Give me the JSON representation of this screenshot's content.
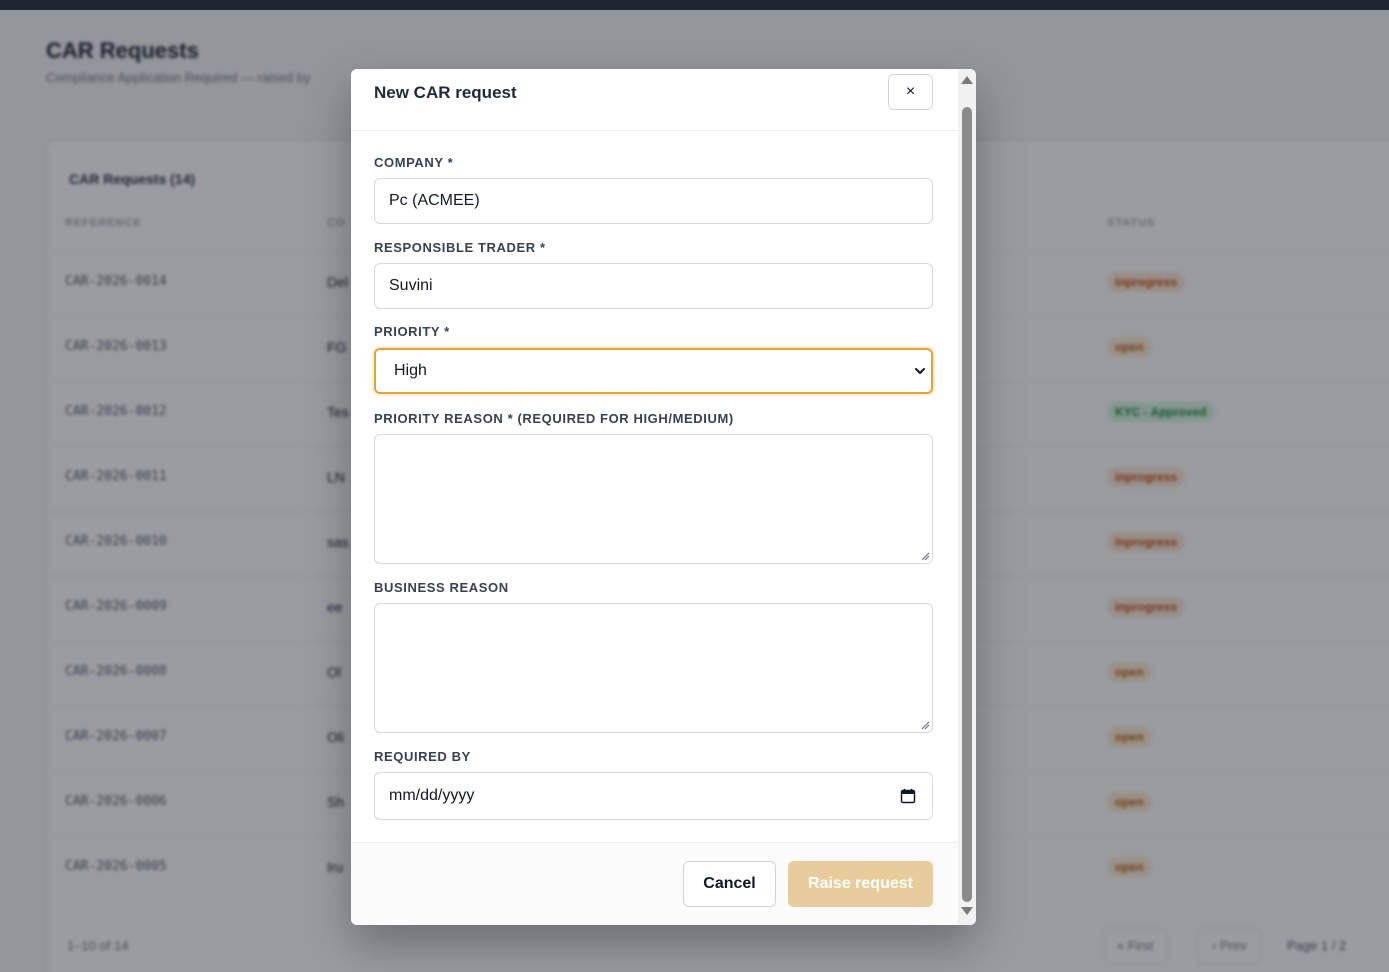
{
  "page": {
    "title": "CAR Requests",
    "subtitle": "Compliance Application Required — raised by"
  },
  "table": {
    "card_title": "CAR Requests (14)",
    "columns": [
      "REFERENCE",
      "CO",
      "STATUS"
    ],
    "rows": [
      {
        "ref": "CAR-2026-0014",
        "company": "Del",
        "status": "inprogress",
        "kind": "inprogress"
      },
      {
        "ref": "CAR-2026-0013",
        "company": "FG",
        "status": "open",
        "kind": "open"
      },
      {
        "ref": "CAR-2026-0012",
        "company": "Tes",
        "status": "KYC - Approved",
        "kind": "approved"
      },
      {
        "ref": "CAR-2026-0011",
        "company": "LN",
        "status": "inprogress",
        "kind": "inprogress"
      },
      {
        "ref": "CAR-2026-0010",
        "company": "sas",
        "status": "inprogress",
        "kind": "inprogress"
      },
      {
        "ref": "CAR-2026-0009",
        "company": "ee",
        "status": "inprogress",
        "kind": "inprogress"
      },
      {
        "ref": "CAR-2026-0008",
        "company": "Ol",
        "status": "open",
        "kind": "open"
      },
      {
        "ref": "CAR-2026-0007",
        "company": "Oli",
        "status": "open",
        "kind": "open"
      },
      {
        "ref": "CAR-2026-0006",
        "company": "Sh",
        "status": "open",
        "kind": "open"
      },
      {
        "ref": "CAR-2026-0005",
        "company": "Iru",
        "status": "open",
        "kind": "open"
      }
    ],
    "footer_count": "1–10 of 14",
    "pagination": {
      "first": "« First",
      "prev": "‹ Prev",
      "page_label": "Page 1 / 2"
    }
  },
  "modal": {
    "title": "New CAR request",
    "close_label": "×",
    "fields": {
      "company": {
        "label": "COMPANY *",
        "value": "Pc (ACMEE)"
      },
      "trader": {
        "label": "RESPONSIBLE TRADER *",
        "value": "Suvini"
      },
      "priority": {
        "label": "PRIORITY *",
        "value": "High"
      },
      "priority_reason": {
        "label": "PRIORITY REASON * (REQUIRED FOR HIGH/MEDIUM)",
        "value": ""
      },
      "business_reason": {
        "label": "BUSINESS REASON",
        "value": ""
      },
      "required_by": {
        "label": "REQUIRED BY",
        "placeholder": "mm/dd/yyyy"
      }
    },
    "buttons": {
      "cancel": "Cancel",
      "raise": "Raise request"
    }
  },
  "colors": {
    "accent": "#e0a43a",
    "raise_button_disabled": "#e8cc9b",
    "status_inprogress": "#c2410c",
    "status_open": "#b45309",
    "status_approved": "#15803d"
  },
  "icons": {
    "close": "close-icon",
    "select": "chevron-down-icon",
    "date": "calendar-icon"
  }
}
